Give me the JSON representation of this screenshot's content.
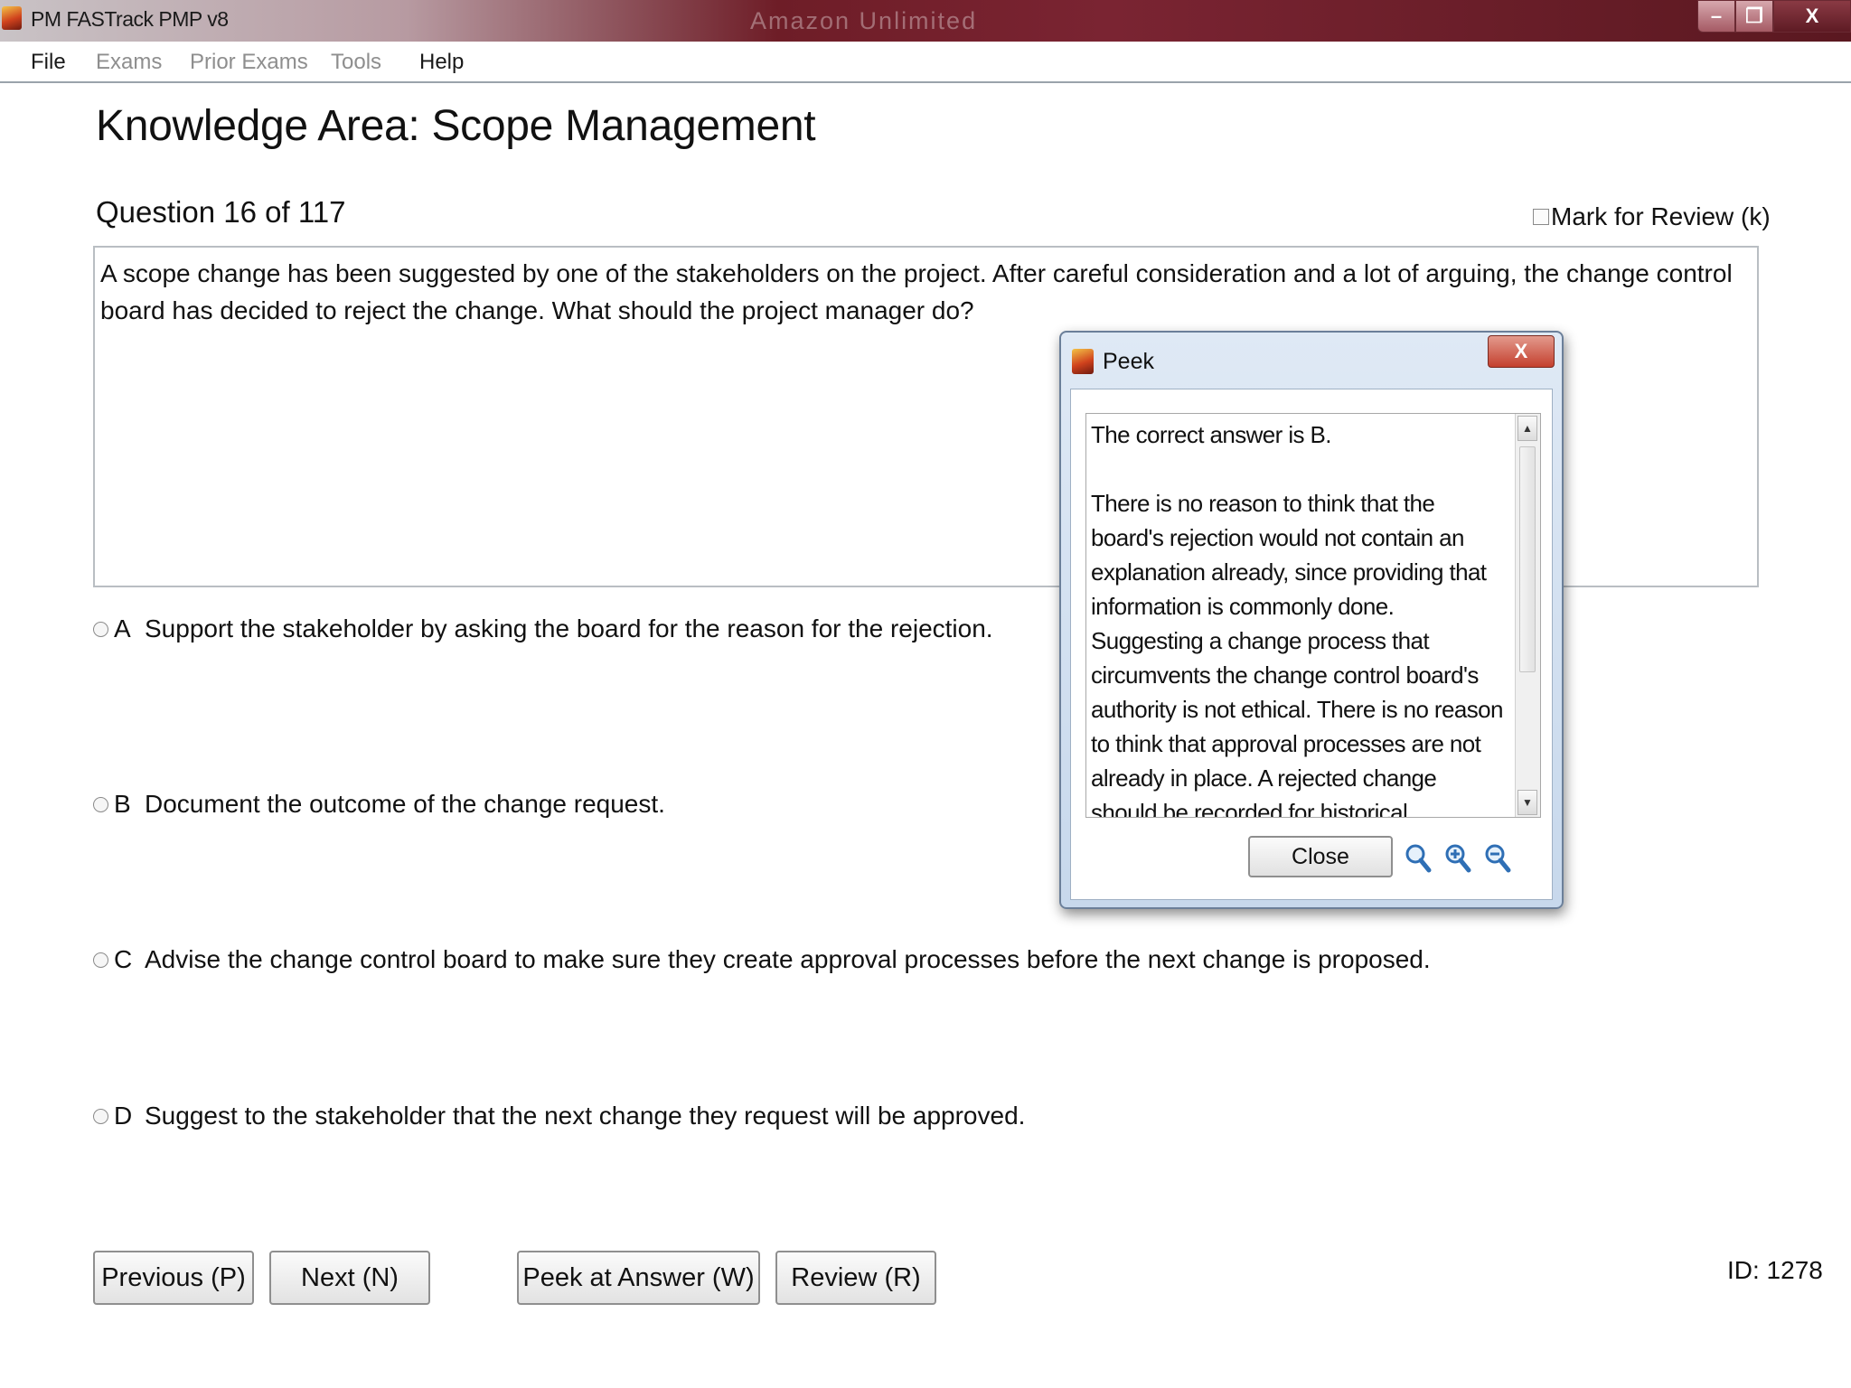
{
  "window": {
    "title": "PM FASTrack PMP v8",
    "blurred_text": "Amazon Unlimited",
    "controls": {
      "minimize": "–",
      "maximize": "❐",
      "close": "X"
    }
  },
  "menu": {
    "items": [
      {
        "label": "File",
        "enabled": true
      },
      {
        "label": "Exams",
        "enabled": false
      },
      {
        "label": "Prior Exams",
        "enabled": false
      },
      {
        "label": "Tools",
        "enabled": false
      },
      {
        "label": "Help",
        "enabled": true
      }
    ]
  },
  "page": {
    "title": "Knowledge Area: Scope Management",
    "question_counter": "Question 16 of 117",
    "mark_for_review": "Mark for Review (k)",
    "question_text": "A scope change has been suggested by one of the stakeholders on the project. After careful consideration and a lot of arguing, the change control board has decided to reject the change. What should the project manager do?"
  },
  "answers": [
    {
      "letter": "A",
      "text": "Support the stakeholder by asking the board for the reason for the rejection."
    },
    {
      "letter": "B",
      "text": "Document the outcome of the change request."
    },
    {
      "letter": "C",
      "text": "Advise the change control board to make sure they create approval processes before the next change is proposed."
    },
    {
      "letter": "D",
      "text": "Suggest to the stakeholder that the next change they request will be approved."
    }
  ],
  "buttons": {
    "previous": "Previous (P)",
    "next": "Next (N)",
    "peek": "Peek at Answer (W)",
    "review": "Review (R)"
  },
  "id_label": "ID: 1278",
  "peek_dialog": {
    "title": "Peek",
    "close_x": "X",
    "text": "The correct answer is B.\n\nThere is no reason to think that the board's rejection would not contain an explanation already, since providing that information is commonly done. Suggesting a change process that circumvents the change control board's authority is not ethical. There is no reason to think that approval processes are not already in place. A rejected change should be recorded for historical purposes, in",
    "close_button": "Close",
    "scroll_up": "▲",
    "scroll_down": "▼",
    "icons": [
      "zoom-reset-icon",
      "zoom-in-icon",
      "zoom-out-icon"
    ]
  }
}
